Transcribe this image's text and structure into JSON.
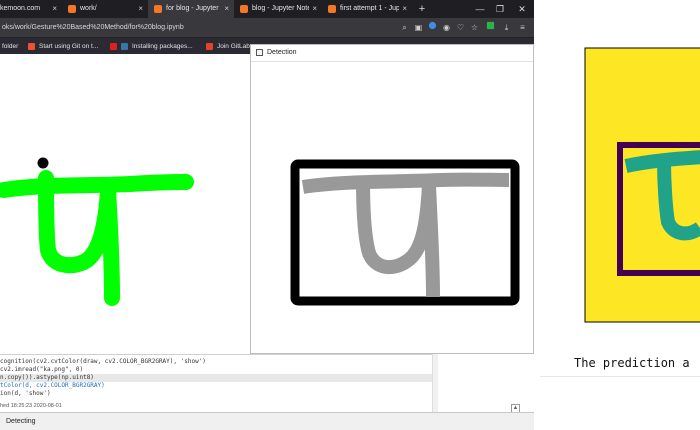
{
  "browser": {
    "tabs": [
      {
        "label": "kemoon.com",
        "favicon_color": "#2d5bd7",
        "active": false
      },
      {
        "label": "work/",
        "favicon_color": "#f37726",
        "active": false
      },
      {
        "label": "for blog - Jupyter N",
        "favicon_color": "#f37726",
        "active": true
      },
      {
        "label": "blog - Jupyter Note",
        "favicon_color": "#f37726",
        "active": false
      },
      {
        "label": "first attempt 1 - Jupy",
        "favicon_color": "#f37726",
        "active": false
      }
    ],
    "new_tab": "+",
    "window_controls": {
      "minimize": "—",
      "restore": "❐",
      "close": "✕"
    },
    "url": "oks/work/Gesture%20Based%20Method/for%20blog.ipynb",
    "bookmarks": [
      {
        "label": "folder",
        "icon_color": "#f5c542"
      },
      {
        "label": "Start using Git on t...",
        "icon_color": "#f05033"
      },
      {
        "label": "Installing packages...",
        "icon_color": "#3776ab"
      },
      {
        "label": "Join GitLab",
        "icon_color": "#e24329"
      }
    ]
  },
  "notebook": {
    "code_lines": [
      "cognition(cv2.cvtColor(draw, cv2.COLOR_BGR2GRAY), 'show')",
      "cv2.imread(\"ka.png\", 0)",
      "n.copy()).astype(np.uint8)",
      "tColor(d, cv2.COLOR_BGR2GRAY)",
      "ion(d, 'show')"
    ],
    "executed": "hed 18:25:23 2020-08-01",
    "status": "Detecting"
  },
  "detection_window": {
    "title": "Detection"
  },
  "plot": {
    "prediction_text": "The prediction a"
  },
  "colors": {
    "chrome_dark": "#1f1f23",
    "stroke_green": "#00ff00",
    "plot_yellow": "#fde725",
    "plot_purple": "#440154",
    "plot_teal": "#21a38a"
  }
}
